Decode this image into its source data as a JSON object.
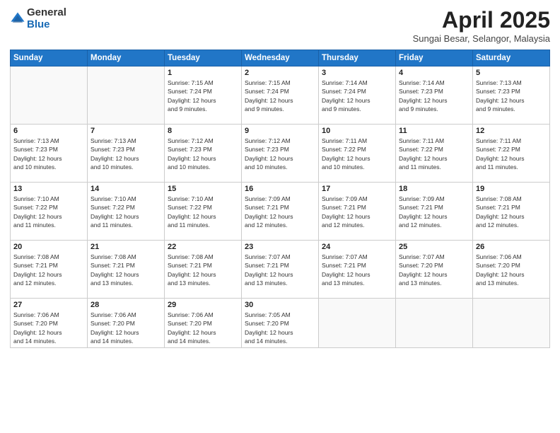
{
  "logo": {
    "general": "General",
    "blue": "Blue"
  },
  "header": {
    "month": "April 2025",
    "location": "Sungai Besar, Selangor, Malaysia"
  },
  "weekdays": [
    "Sunday",
    "Monday",
    "Tuesday",
    "Wednesday",
    "Thursday",
    "Friday",
    "Saturday"
  ],
  "weeks": [
    [
      {
        "day": "",
        "info": ""
      },
      {
        "day": "",
        "info": ""
      },
      {
        "day": "1",
        "info": "Sunrise: 7:15 AM\nSunset: 7:24 PM\nDaylight: 12 hours\nand 9 minutes."
      },
      {
        "day": "2",
        "info": "Sunrise: 7:15 AM\nSunset: 7:24 PM\nDaylight: 12 hours\nand 9 minutes."
      },
      {
        "day": "3",
        "info": "Sunrise: 7:14 AM\nSunset: 7:24 PM\nDaylight: 12 hours\nand 9 minutes."
      },
      {
        "day": "4",
        "info": "Sunrise: 7:14 AM\nSunset: 7:23 PM\nDaylight: 12 hours\nand 9 minutes."
      },
      {
        "day": "5",
        "info": "Sunrise: 7:13 AM\nSunset: 7:23 PM\nDaylight: 12 hours\nand 9 minutes."
      }
    ],
    [
      {
        "day": "6",
        "info": "Sunrise: 7:13 AM\nSunset: 7:23 PM\nDaylight: 12 hours\nand 10 minutes."
      },
      {
        "day": "7",
        "info": "Sunrise: 7:13 AM\nSunset: 7:23 PM\nDaylight: 12 hours\nand 10 minutes."
      },
      {
        "day": "8",
        "info": "Sunrise: 7:12 AM\nSunset: 7:23 PM\nDaylight: 12 hours\nand 10 minutes."
      },
      {
        "day": "9",
        "info": "Sunrise: 7:12 AM\nSunset: 7:23 PM\nDaylight: 12 hours\nand 10 minutes."
      },
      {
        "day": "10",
        "info": "Sunrise: 7:11 AM\nSunset: 7:22 PM\nDaylight: 12 hours\nand 10 minutes."
      },
      {
        "day": "11",
        "info": "Sunrise: 7:11 AM\nSunset: 7:22 PM\nDaylight: 12 hours\nand 11 minutes."
      },
      {
        "day": "12",
        "info": "Sunrise: 7:11 AM\nSunset: 7:22 PM\nDaylight: 12 hours\nand 11 minutes."
      }
    ],
    [
      {
        "day": "13",
        "info": "Sunrise: 7:10 AM\nSunset: 7:22 PM\nDaylight: 12 hours\nand 11 minutes."
      },
      {
        "day": "14",
        "info": "Sunrise: 7:10 AM\nSunset: 7:22 PM\nDaylight: 12 hours\nand 11 minutes."
      },
      {
        "day": "15",
        "info": "Sunrise: 7:10 AM\nSunset: 7:22 PM\nDaylight: 12 hours\nand 11 minutes."
      },
      {
        "day": "16",
        "info": "Sunrise: 7:09 AM\nSunset: 7:21 PM\nDaylight: 12 hours\nand 12 minutes."
      },
      {
        "day": "17",
        "info": "Sunrise: 7:09 AM\nSunset: 7:21 PM\nDaylight: 12 hours\nand 12 minutes."
      },
      {
        "day": "18",
        "info": "Sunrise: 7:09 AM\nSunset: 7:21 PM\nDaylight: 12 hours\nand 12 minutes."
      },
      {
        "day": "19",
        "info": "Sunrise: 7:08 AM\nSunset: 7:21 PM\nDaylight: 12 hours\nand 12 minutes."
      }
    ],
    [
      {
        "day": "20",
        "info": "Sunrise: 7:08 AM\nSunset: 7:21 PM\nDaylight: 12 hours\nand 12 minutes."
      },
      {
        "day": "21",
        "info": "Sunrise: 7:08 AM\nSunset: 7:21 PM\nDaylight: 12 hours\nand 13 minutes."
      },
      {
        "day": "22",
        "info": "Sunrise: 7:08 AM\nSunset: 7:21 PM\nDaylight: 12 hours\nand 13 minutes."
      },
      {
        "day": "23",
        "info": "Sunrise: 7:07 AM\nSunset: 7:21 PM\nDaylight: 12 hours\nand 13 minutes."
      },
      {
        "day": "24",
        "info": "Sunrise: 7:07 AM\nSunset: 7:21 PM\nDaylight: 12 hours\nand 13 minutes."
      },
      {
        "day": "25",
        "info": "Sunrise: 7:07 AM\nSunset: 7:20 PM\nDaylight: 12 hours\nand 13 minutes."
      },
      {
        "day": "26",
        "info": "Sunrise: 7:06 AM\nSunset: 7:20 PM\nDaylight: 12 hours\nand 13 minutes."
      }
    ],
    [
      {
        "day": "27",
        "info": "Sunrise: 7:06 AM\nSunset: 7:20 PM\nDaylight: 12 hours\nand 14 minutes."
      },
      {
        "day": "28",
        "info": "Sunrise: 7:06 AM\nSunset: 7:20 PM\nDaylight: 12 hours\nand 14 minutes."
      },
      {
        "day": "29",
        "info": "Sunrise: 7:06 AM\nSunset: 7:20 PM\nDaylight: 12 hours\nand 14 minutes."
      },
      {
        "day": "30",
        "info": "Sunrise: 7:05 AM\nSunset: 7:20 PM\nDaylight: 12 hours\nand 14 minutes."
      },
      {
        "day": "",
        "info": ""
      },
      {
        "day": "",
        "info": ""
      },
      {
        "day": "",
        "info": ""
      }
    ]
  ]
}
